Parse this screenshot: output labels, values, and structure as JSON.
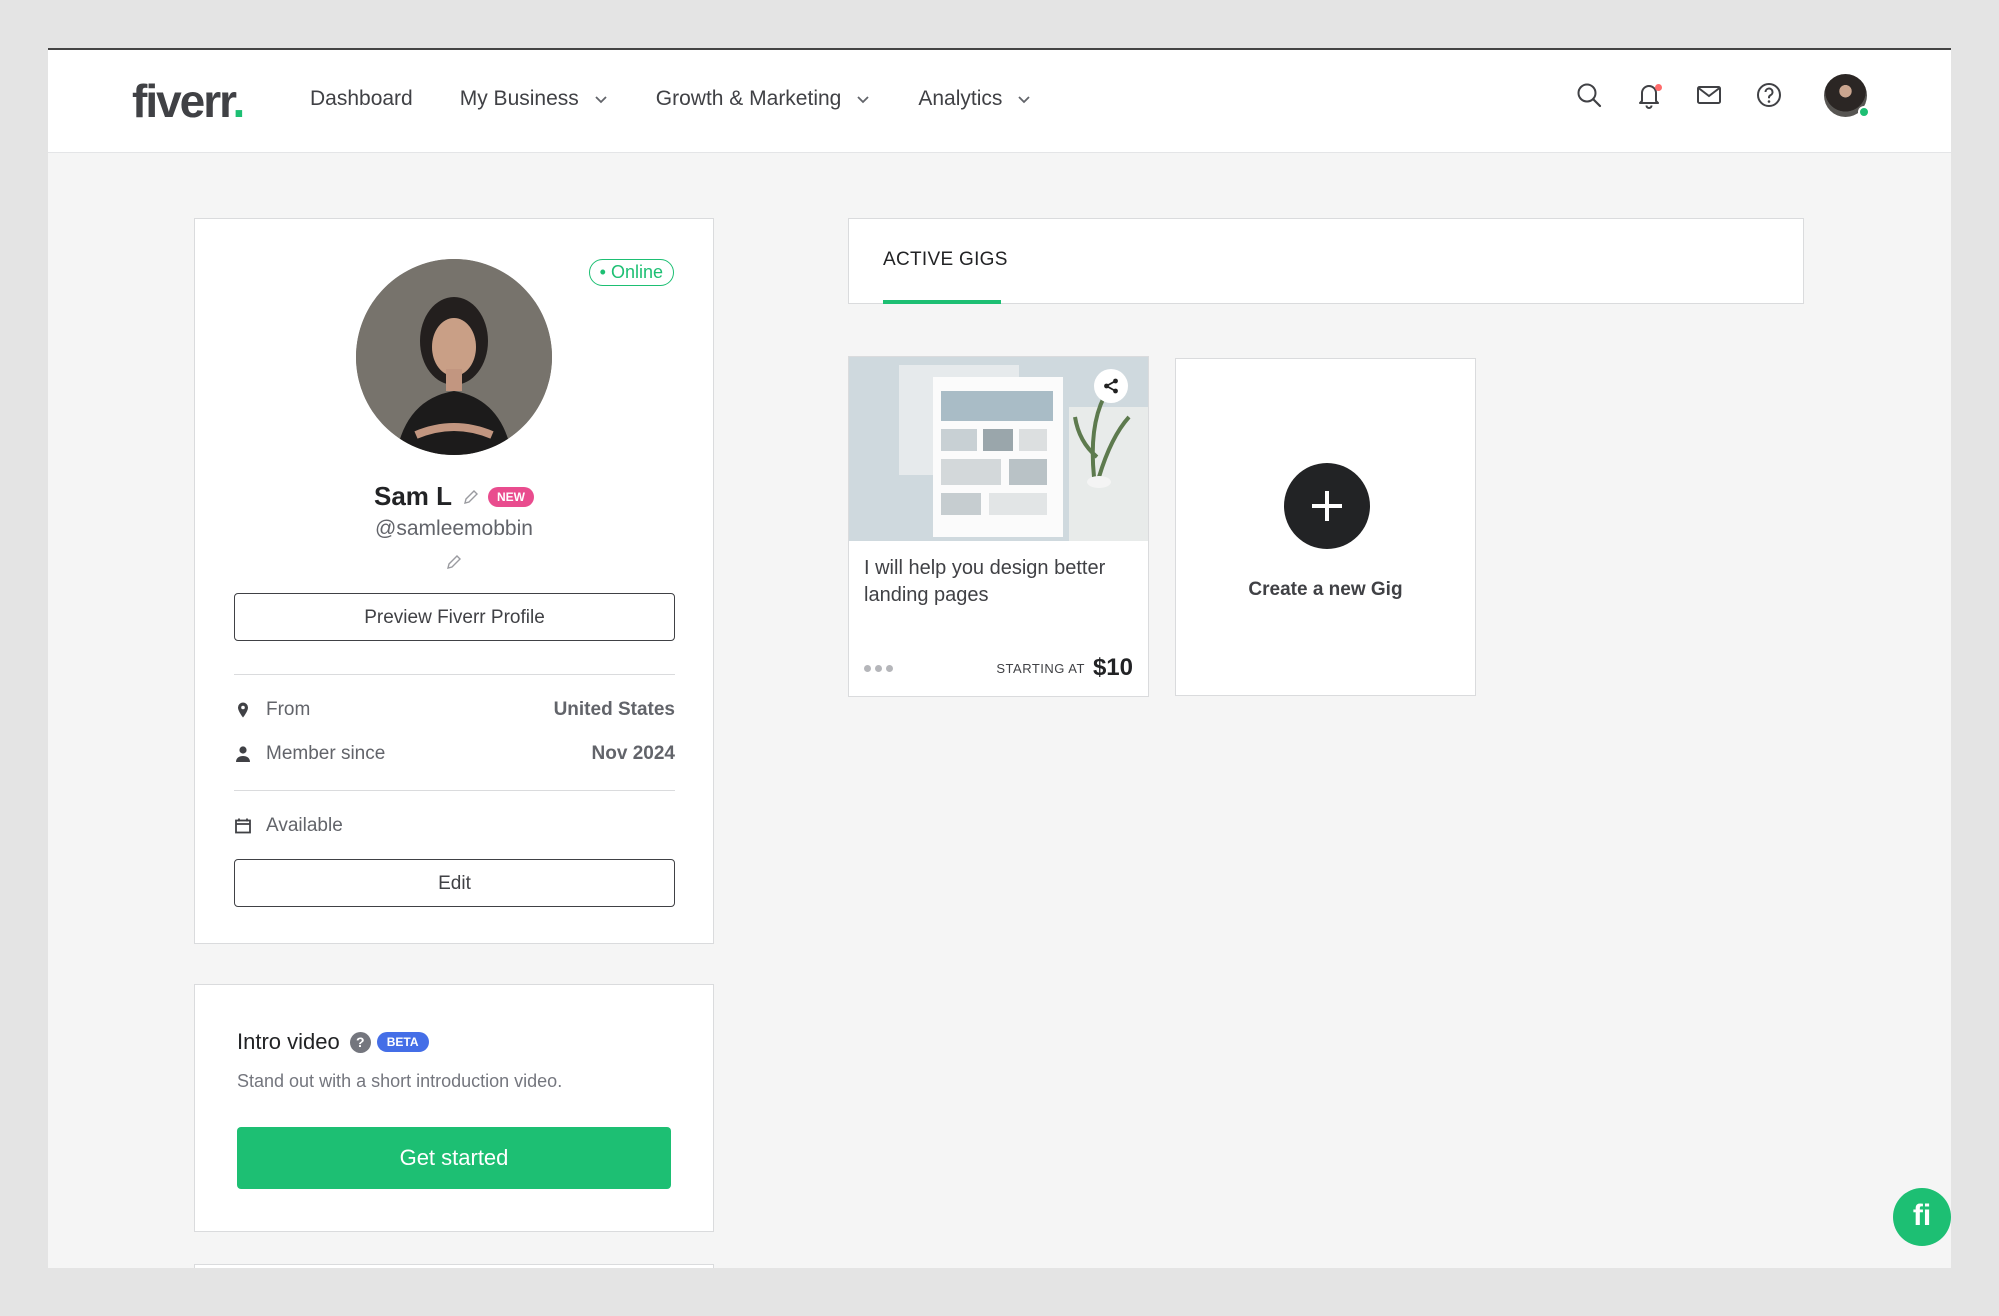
{
  "brand": {
    "logo_text": "fiverr",
    "logo_dot": "."
  },
  "nav": {
    "items": [
      {
        "label": "Dashboard",
        "has_dropdown": false
      },
      {
        "label": "My Business",
        "has_dropdown": true
      },
      {
        "label": "Growth & Marketing",
        "has_dropdown": true
      },
      {
        "label": "Analytics",
        "has_dropdown": true
      }
    ]
  },
  "header_icons": [
    "search-icon",
    "bell-icon",
    "mail-icon",
    "help-icon"
  ],
  "profile": {
    "status": "• Online",
    "name": "Sam L",
    "badge": "NEW",
    "username": "@samleemobbin",
    "preview_button": "Preview Fiverr Profile",
    "from_label": "From",
    "from_value": "United States",
    "member_since_label": "Member since",
    "member_since_value": "Nov 2024",
    "availability_label": "Available",
    "edit_button": "Edit"
  },
  "intro_video": {
    "title": "Intro video",
    "help_glyph": "?",
    "badge": "BETA",
    "subtitle": "Stand out with a short introduction video.",
    "cta": "Get started"
  },
  "gigs": {
    "tab_label": "ACTIVE GIGS",
    "items": [
      {
        "title": "I will help you design better landing pages",
        "starting_label": "STARTING AT",
        "price": "$10"
      }
    ],
    "create_label": "Create a new Gig"
  },
  "chat_badge": "fi",
  "colors": {
    "accent": "#1dbf73",
    "new_badge": "#e94c8e",
    "beta_badge": "#446ee7",
    "text": "#404145"
  }
}
